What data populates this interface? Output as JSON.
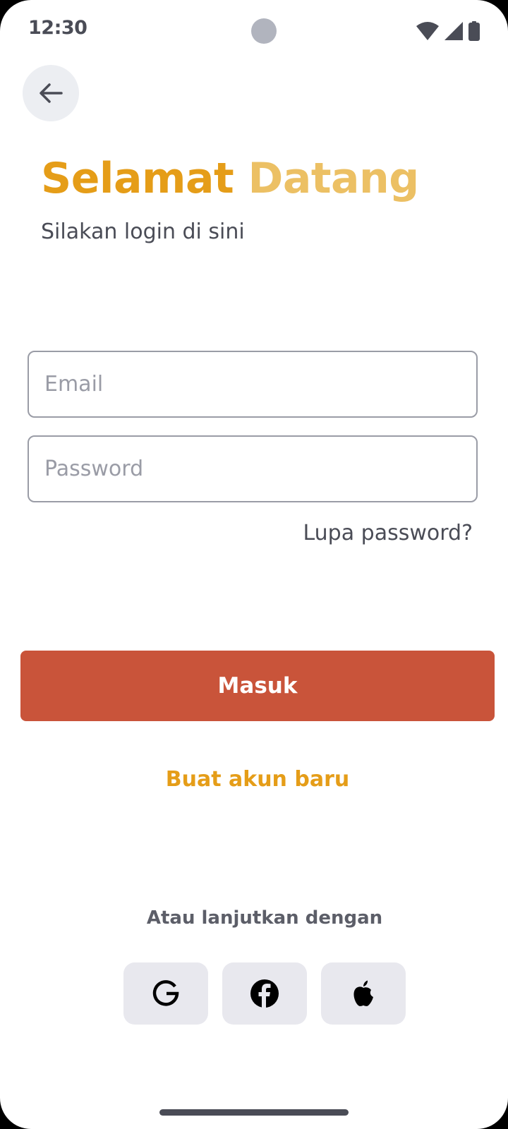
{
  "status_bar": {
    "time": "12:30",
    "icons": [
      "wifi-icon",
      "signal-icon",
      "battery-icon"
    ]
  },
  "header": {
    "back_icon": "arrow-left-icon",
    "title_part1": "Selamat",
    "title_part2": "Datang",
    "subtitle": "Silakan login di sini"
  },
  "form": {
    "email_placeholder": "Email",
    "password_placeholder": "Password",
    "forgot_password": "Lupa password?"
  },
  "actions": {
    "login_label": "Masuk",
    "register_label": "Buat akun baru"
  },
  "social": {
    "label": "Atau lanjutkan dengan",
    "providers": [
      "google-icon",
      "facebook-icon",
      "apple-icon"
    ]
  },
  "colors": {
    "accent": "#e59d18",
    "accent_light": "#ecc064",
    "primary_button": "#c9543a",
    "text_dark": "#4a4c56",
    "border": "#9a9ca6",
    "social_bg": "#e8e8ee"
  }
}
